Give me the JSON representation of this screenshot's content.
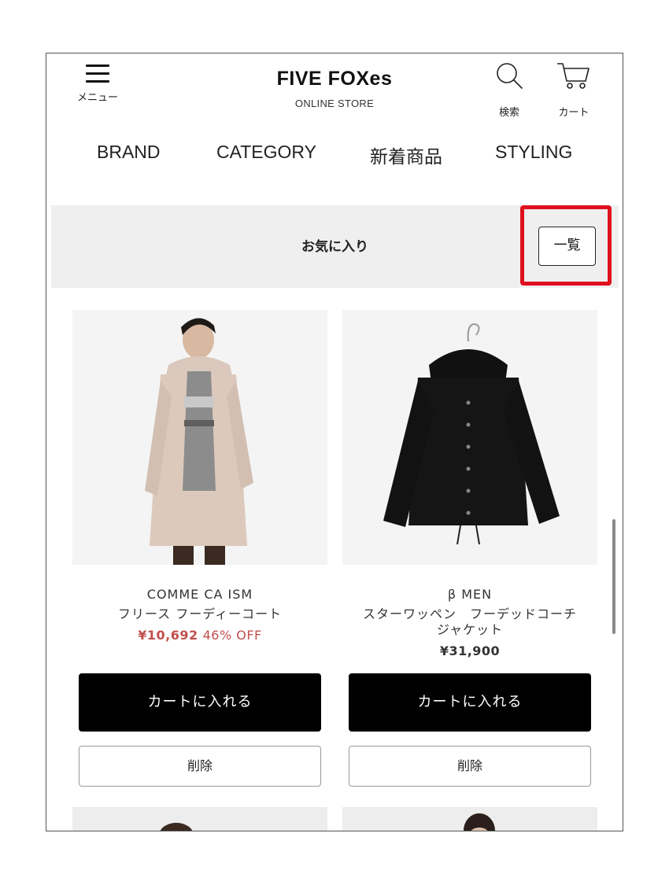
{
  "header": {
    "menu_label": "メニュー",
    "logo": "FIVE FOXes",
    "logo_sub": "ONLINE STORE",
    "search_label": "検索",
    "cart_label": "カート"
  },
  "nav": [
    "BRAND",
    "CATEGORY",
    "新着商品",
    "STYLING"
  ],
  "favorites": {
    "title": "お気に入り",
    "list_button": "一覧",
    "highlight_color": "#e0101e"
  },
  "products": [
    {
      "brand": "COMME CA ISM",
      "name": "フリース フーディーコート",
      "price": "¥10,692",
      "discount": "46% OFF",
      "add_to_cart": "カートに入れる",
      "remove": "削除"
    },
    {
      "brand": "β MEN",
      "name_line1": "スターワッペン　フーデッドコーチ",
      "name_line2": "ジャケット",
      "price": "¥31,900",
      "add_to_cart": "カートに入れる",
      "remove": "削除"
    }
  ],
  "colors": {
    "sale_price": "#c0504d",
    "button_dark": "#000000",
    "banner_bg": "#efefef"
  }
}
